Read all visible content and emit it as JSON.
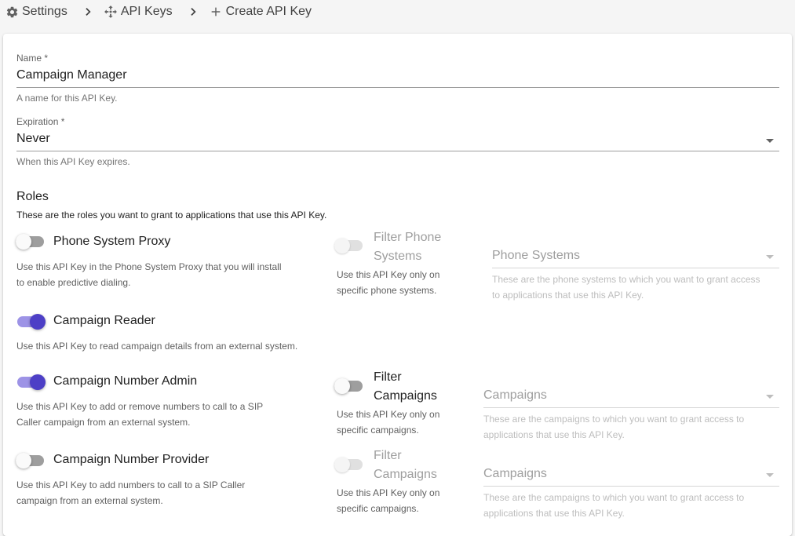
{
  "breadcrumb": {
    "settings": "Settings",
    "api_keys": "API Keys",
    "create": "Create API Key"
  },
  "form": {
    "name": {
      "label": "Name *",
      "value": "Campaign Manager",
      "helper": "A name for this API Key."
    },
    "expiration": {
      "label": "Expiration *",
      "value": "Never",
      "helper": "When this API Key expires."
    }
  },
  "roles": {
    "title": "Roles",
    "description": "These are the roles you want to grant to applications that use this API Key.",
    "items": [
      {
        "label": "Phone System Proxy",
        "enabled": false,
        "help": [
          "Use this API Key in the Phone System Proxy that you will install",
          "to enable predictive dialing."
        ],
        "filter": {
          "label": [
            "Filter Phone",
            "Systems"
          ],
          "enabled": false,
          "disabled": true,
          "help": [
            "Use this API Key only on",
            "specific phone systems."
          ],
          "select_placeholder": "Phone Systems",
          "select_help": [
            "These are the phone systems to which you want to grant access",
            "to applications that use this API Key."
          ]
        }
      },
      {
        "label": "Campaign Reader",
        "enabled": true,
        "help": [
          "Use this API Key to read campaign details from an external system."
        ]
      },
      {
        "label": "Campaign Number Admin",
        "enabled": true,
        "help": [
          "Use this API Key to add or remove numbers to call to a SIP",
          "Caller campaign from an external system."
        ],
        "filter": {
          "label": [
            "Filter",
            "Campaigns"
          ],
          "enabled": false,
          "disabled": false,
          "help": [
            "Use this API Key only on",
            "specific campaigns."
          ],
          "select_placeholder": "Campaigns",
          "select_help": [
            "These are the campaigns to which you want to grant access to",
            "applications that use this API Key."
          ]
        }
      },
      {
        "label": "Campaign Number Provider",
        "enabled": false,
        "help": [
          "Use this API Key to add numbers to call to a SIP Caller",
          "campaign from an external system."
        ],
        "filter": {
          "label": [
            "Filter",
            "Campaigns"
          ],
          "enabled": false,
          "disabled": true,
          "help": [
            "Use this API Key only on",
            "specific campaigns."
          ],
          "select_placeholder": "Campaigns",
          "select_help": [
            "These are the campaigns to which you want to grant access to",
            "applications that use this API Key."
          ]
        }
      }
    ]
  },
  "colors": {
    "accent": "#4d3fc6",
    "accent_track": "#9d93e6"
  },
  "icons": {
    "settings": "gear-icon",
    "api_keys": "move-arrows-icon",
    "create": "plus-icon",
    "separator": "chevron-right-icon",
    "select": "dropdown-caret-icon"
  }
}
